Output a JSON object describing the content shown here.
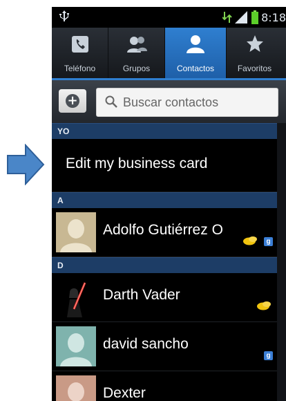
{
  "status": {
    "time": "8:18",
    "icons": [
      "usb-icon",
      "data-arrows-icon",
      "signal-icon",
      "battery-icon"
    ]
  },
  "tabs": [
    {
      "label": "Teléfono",
      "icon": "phone-icon",
      "active": false
    },
    {
      "label": "Grupos",
      "icon": "group-icon",
      "active": false
    },
    {
      "label": "Contactos",
      "icon": "person-icon",
      "active": true
    },
    {
      "label": "Favoritos",
      "icon": "star-icon",
      "active": false
    }
  ],
  "search": {
    "placeholder": "Buscar contactos"
  },
  "sections": {
    "yo": "YO",
    "a": "A",
    "d": "D"
  },
  "business_card": {
    "label": "Edit my business card"
  },
  "contacts": [
    {
      "name": "Adolfo Gutiérrez O",
      "avatar": "default-avatar-tan",
      "yellow_badge": true,
      "google_badge": true
    },
    {
      "name": "Darth Vader",
      "avatar": "darth-vader-photo",
      "yellow_badge": true,
      "google_badge": false
    },
    {
      "name": "david sancho",
      "avatar": "default-avatar-teal",
      "yellow_badge": false,
      "google_badge": true
    },
    {
      "name": "Dexter",
      "avatar": "default-avatar-rose",
      "yellow_badge": true,
      "google_badge": false
    }
  ],
  "colors": {
    "accent": "#2f7fd0",
    "section_header": "#1d3d66",
    "pointer_arrow": "#4a86c8"
  }
}
